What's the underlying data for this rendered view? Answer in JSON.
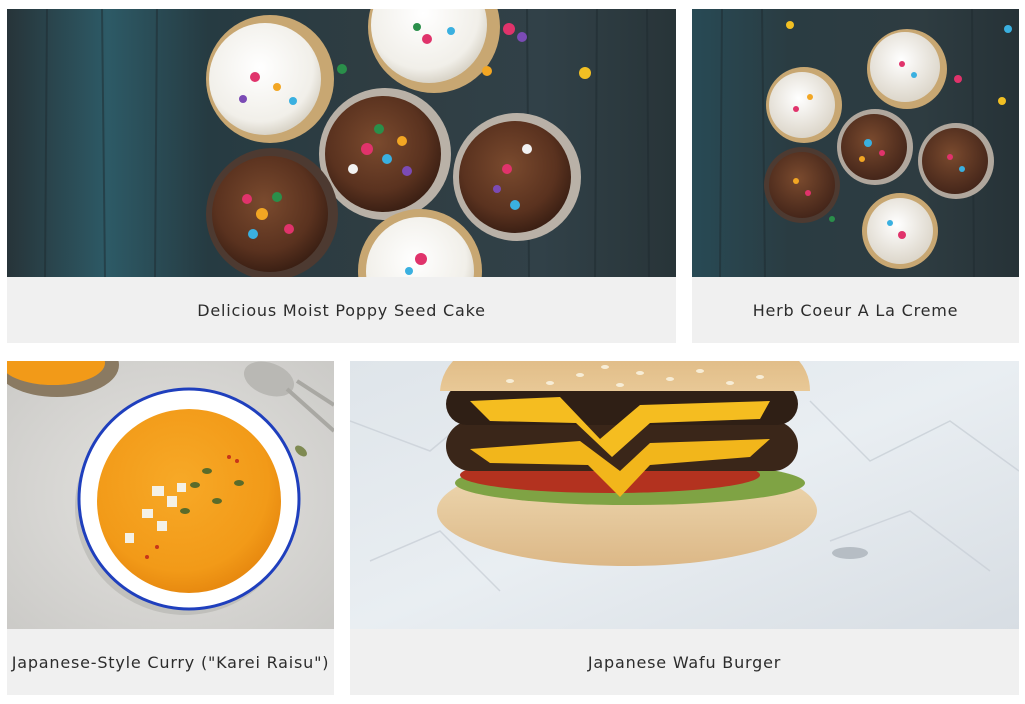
{
  "recipes": [
    {
      "title": "Delicious Moist Poppy Seed Cake"
    },
    {
      "title": "Herb Coeur A La Creme"
    },
    {
      "title": "Japanese-Style Curry (\"Karei Raisu\")"
    },
    {
      "title": "Japanese Wafu Burger"
    }
  ],
  "colors": {
    "caption_background": "#f0f0f0",
    "caption_text": "#2c2c2c",
    "wood_background": "#2f3f45",
    "table_background": "#d9d9d7",
    "paper_background": "#e6ebef"
  }
}
